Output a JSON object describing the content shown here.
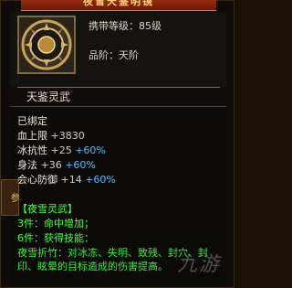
{
  "tooltip": {
    "title": "夜雪天鉴明镜",
    "level_line": "携带等级：85级",
    "quality_line": "品阶：天阶",
    "section_name": "天鉴灵武",
    "side_tab": "参",
    "bound": "已绑定",
    "stats": [
      {
        "label": "血上限",
        "value": "+3830",
        "pct": ""
      },
      {
        "label": "冰抗性",
        "value": "+25",
        "pct": "+60%"
      },
      {
        "label": "身法",
        "value": "+36",
        "pct": "+60%"
      },
      {
        "label": "会心防御",
        "value": "+14",
        "pct": "+60%"
      }
    ],
    "set": {
      "name": "【夜雪灵武】",
      "tier3": "3件：命中增加；",
      "tier6": "6件：获得技能：",
      "skill_desc": "夜雪折竹：对冰冻、失明、致残、封穴、封印、眩晕的目标造成的伤害提高。"
    },
    "watermark": "九游"
  },
  "colors": {
    "set_green": "#44ff44",
    "percent_blue": "#55bfff",
    "title_red": "#9a2c10"
  }
}
